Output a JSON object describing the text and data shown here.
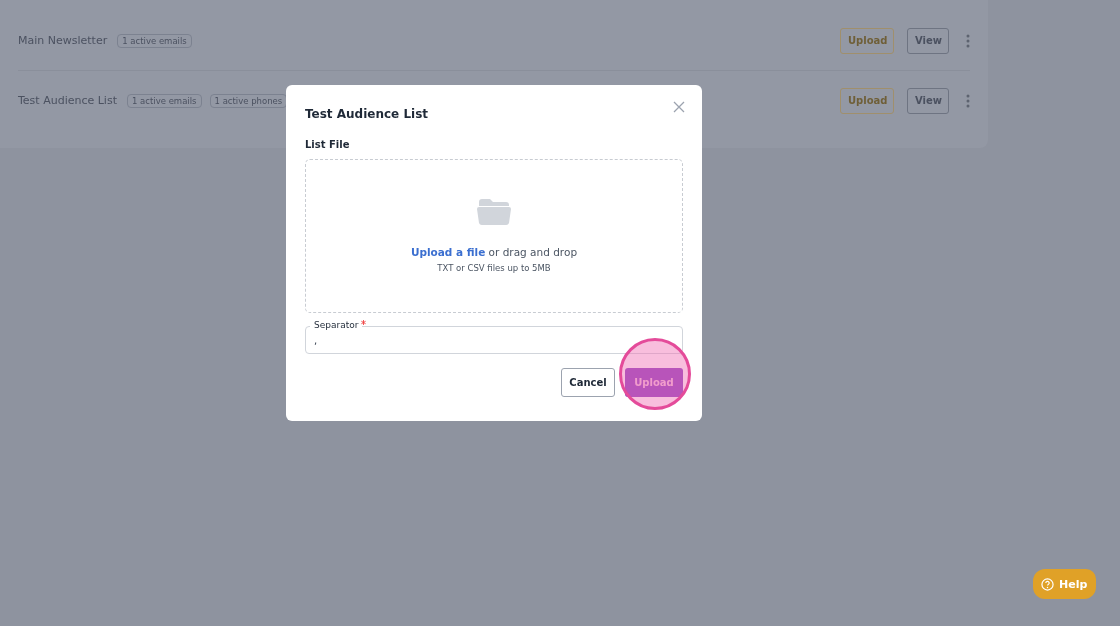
{
  "lists": [
    {
      "name": "Main Newsletter",
      "badges": [
        "1 active emails"
      ],
      "upload": "Upload",
      "view": "View"
    },
    {
      "name": "Test Audience List",
      "badges": [
        "1 active emails",
        "1 active phones"
      ],
      "upload": "Upload",
      "view": "View"
    }
  ],
  "modal": {
    "title": "Test Audience List",
    "section_label": "List File",
    "dropzone": {
      "link": "Upload a file",
      "text": "or drag and drop",
      "hint": "TXT or CSV files up to 5MB"
    },
    "separator": {
      "label": "Separator",
      "required": true,
      "value": ","
    },
    "cancel": "Cancel",
    "submit": "Upload",
    "click_highlight": true
  },
  "help": "Help"
}
